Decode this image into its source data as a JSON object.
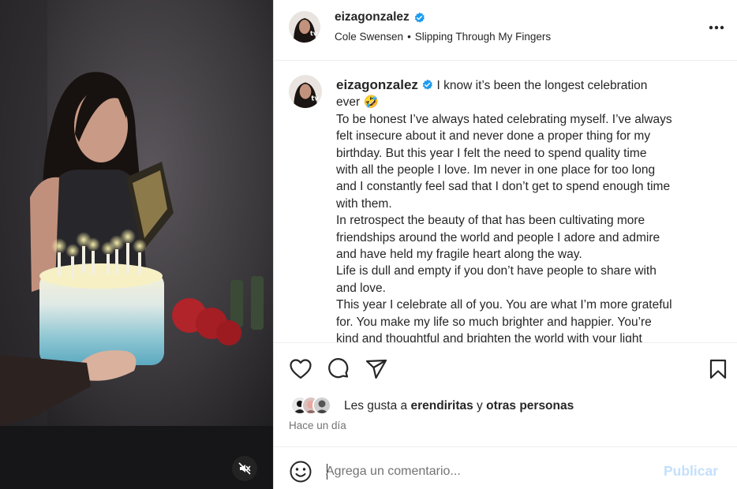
{
  "header": {
    "username": "eizagonzalez",
    "audio_artist": "Cole Swensen",
    "audio_separator": "•",
    "audio_track": "Slipping Through My Fingers"
  },
  "caption": {
    "username": "eizagonzalez",
    "lines": [
      "I know it’s been the longest celebration",
      "ever 🤣",
      "To be honest I’ve always hated celebrating myself. I’ve always",
      "felt insecure about it and never done a proper thing for my",
      "birthday. But this year I felt the need to spend quality time",
      "with all the people I love. Im never in one place for too long",
      "and I constantly feel sad that I don’t get to spend enough time",
      "with them.",
      "In retrospect the beauty of that has been cultivating more",
      "friendships around the world and people I adore and admire",
      "and have held my fragile heart along the way.",
      "Life is dull and empty if you don’t have people to share with",
      "and love.",
      "This year I celebrate all of you. You are what I’m more grateful",
      "for. You make my life so much brighter and happier. You’re",
      "kind and thoughtful and brighten the world with your light"
    ]
  },
  "likes": {
    "prefix": "Les gusta a",
    "user": "erendiritas",
    "connector": "y",
    "others": "otras personas"
  },
  "timestamp": "Hace un día",
  "comment": {
    "placeholder": "Agrega un comentario...",
    "post_label": "Publicar"
  },
  "icons": {
    "more": "more-horizontal-icon",
    "like": "heart-icon",
    "comment": "comment-icon",
    "share": "share-icon",
    "save": "bookmark-icon",
    "emoji": "emoji-icon",
    "mute": "muted-speaker-icon",
    "verified": "verified-badge-icon"
  },
  "colors": {
    "verified": "#1d9bf0",
    "post_disabled": "#c4dffb",
    "secondary_text": "#737373"
  }
}
